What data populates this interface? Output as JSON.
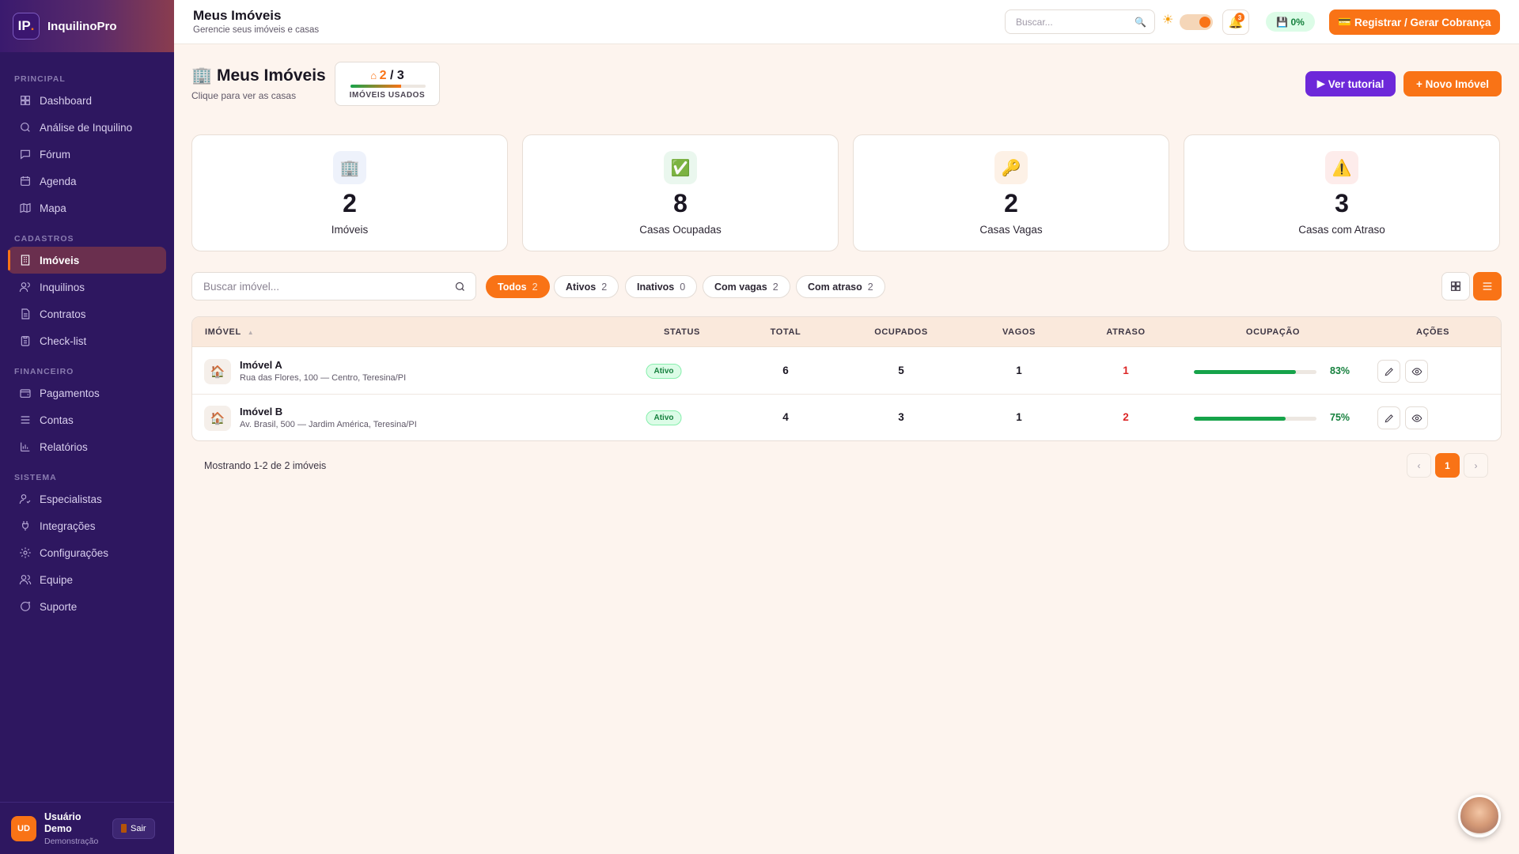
{
  "brand": {
    "logo": "IP",
    "logo_dot": ".",
    "name": "InquilinoPro"
  },
  "sidebar": {
    "sections": [
      {
        "title": "PRINCIPAL",
        "items": [
          {
            "label": "Dashboard",
            "icon": "grid-icon"
          },
          {
            "label": "Análise de Inquilino",
            "icon": "search-icon"
          },
          {
            "label": "Fórum",
            "icon": "chat-icon"
          },
          {
            "label": "Agenda",
            "icon": "calendar-icon"
          },
          {
            "label": "Mapa",
            "icon": "map-icon"
          }
        ]
      },
      {
        "title": "CADASTROS",
        "items": [
          {
            "label": "Imóveis",
            "icon": "building-icon",
            "active": true
          },
          {
            "label": "Inquilinos",
            "icon": "users-icon"
          },
          {
            "label": "Contratos",
            "icon": "document-icon"
          },
          {
            "label": "Check-list",
            "icon": "clipboard-icon"
          }
        ]
      },
      {
        "title": "FINANCEIRO",
        "items": [
          {
            "label": "Pagamentos",
            "icon": "wallet-icon"
          },
          {
            "label": "Contas",
            "icon": "list-icon"
          },
          {
            "label": "Relatórios",
            "icon": "chart-icon"
          }
        ]
      },
      {
        "title": "SISTEMA",
        "items": [
          {
            "label": "Especialistas",
            "icon": "user-check-icon"
          },
          {
            "label": "Integrações",
            "icon": "plug-icon"
          },
          {
            "label": "Configurações",
            "icon": "gear-icon"
          },
          {
            "label": "Equipe",
            "icon": "team-icon"
          },
          {
            "label": "Suporte",
            "icon": "support-icon"
          }
        ]
      }
    ]
  },
  "user": {
    "initials": "UD",
    "name": "Usuário Demo",
    "role": "Demonstração",
    "logout": "Sair"
  },
  "header": {
    "title": "Meus Imóveis",
    "subtitle": "Gerencie seus imóveis e casas",
    "search_placeholder": "Buscar...",
    "notifications": "3",
    "storage": "0%",
    "cobranca": "Registrar / Gerar Cobrança"
  },
  "page": {
    "title": "Meus Imóveis",
    "subtitle": "Clique para ver as casas",
    "usage": {
      "used": "2",
      "total": "3",
      "label": "IMÓVEIS USADOS",
      "fraction": 0.67
    },
    "tutorial": "Ver tutorial",
    "new": "+ Novo Imóvel"
  },
  "stats": [
    {
      "icon": "building-emoji-icon",
      "glyph": "🏢",
      "value": "2",
      "label": "Imóveis",
      "bg": "#eef2fb"
    },
    {
      "icon": "check-emoji-icon",
      "glyph": "✅",
      "value": "8",
      "label": "Casas Ocupadas",
      "bg": "#eaf7ee"
    },
    {
      "icon": "key-emoji-icon",
      "glyph": "🔑",
      "value": "2",
      "label": "Casas Vagas",
      "bg": "#fdf1e6"
    },
    {
      "icon": "warning-emoji-icon",
      "glyph": "⚠️",
      "value": "3",
      "label": "Casas com Atraso",
      "bg": "#fdeceb"
    }
  ],
  "list": {
    "search_placeholder": "Buscar imóvel...",
    "filters": [
      {
        "label": "Todos",
        "count": "2",
        "active": true
      },
      {
        "label": "Ativos",
        "count": "2"
      },
      {
        "label": "Inativos",
        "count": "0"
      },
      {
        "label": "Com vagas",
        "count": "2"
      },
      {
        "label": "Com atraso",
        "count": "2"
      }
    ]
  },
  "table": {
    "columns": [
      "IMÓVEL",
      "STATUS",
      "TOTAL",
      "OCUPADOS",
      "VAGOS",
      "ATRASO",
      "OCUPAÇÃO",
      "AÇÕES"
    ],
    "sort_indicator": "▲",
    "rows": [
      {
        "name": "Imóvel A",
        "address": "Rua das Flores, 100 — Centro, Teresina/PI",
        "status": "Ativo",
        "total": "6",
        "ocupados": "5",
        "vagos": "1",
        "atraso": "1",
        "ocupacao": "83%",
        "ocupacao_frac": 0.83
      },
      {
        "name": "Imóvel B",
        "address": "Av. Brasil, 500 — Jardim América, Teresina/PI",
        "status": "Ativo",
        "total": "4",
        "ocupados": "3",
        "vagos": "1",
        "atraso": "2",
        "ocupacao": "75%",
        "ocupacao_frac": 0.75
      }
    ]
  },
  "pagination": {
    "showing": "Mostrando 1-2 de 2 imóveis",
    "prev": "‹",
    "current": "1",
    "next": "›"
  },
  "colors": {
    "accent": "#f97316",
    "sidebar": "#2e1760",
    "purple": "#6d28d9",
    "success": "#16a34a",
    "danger": "#dc2626"
  }
}
